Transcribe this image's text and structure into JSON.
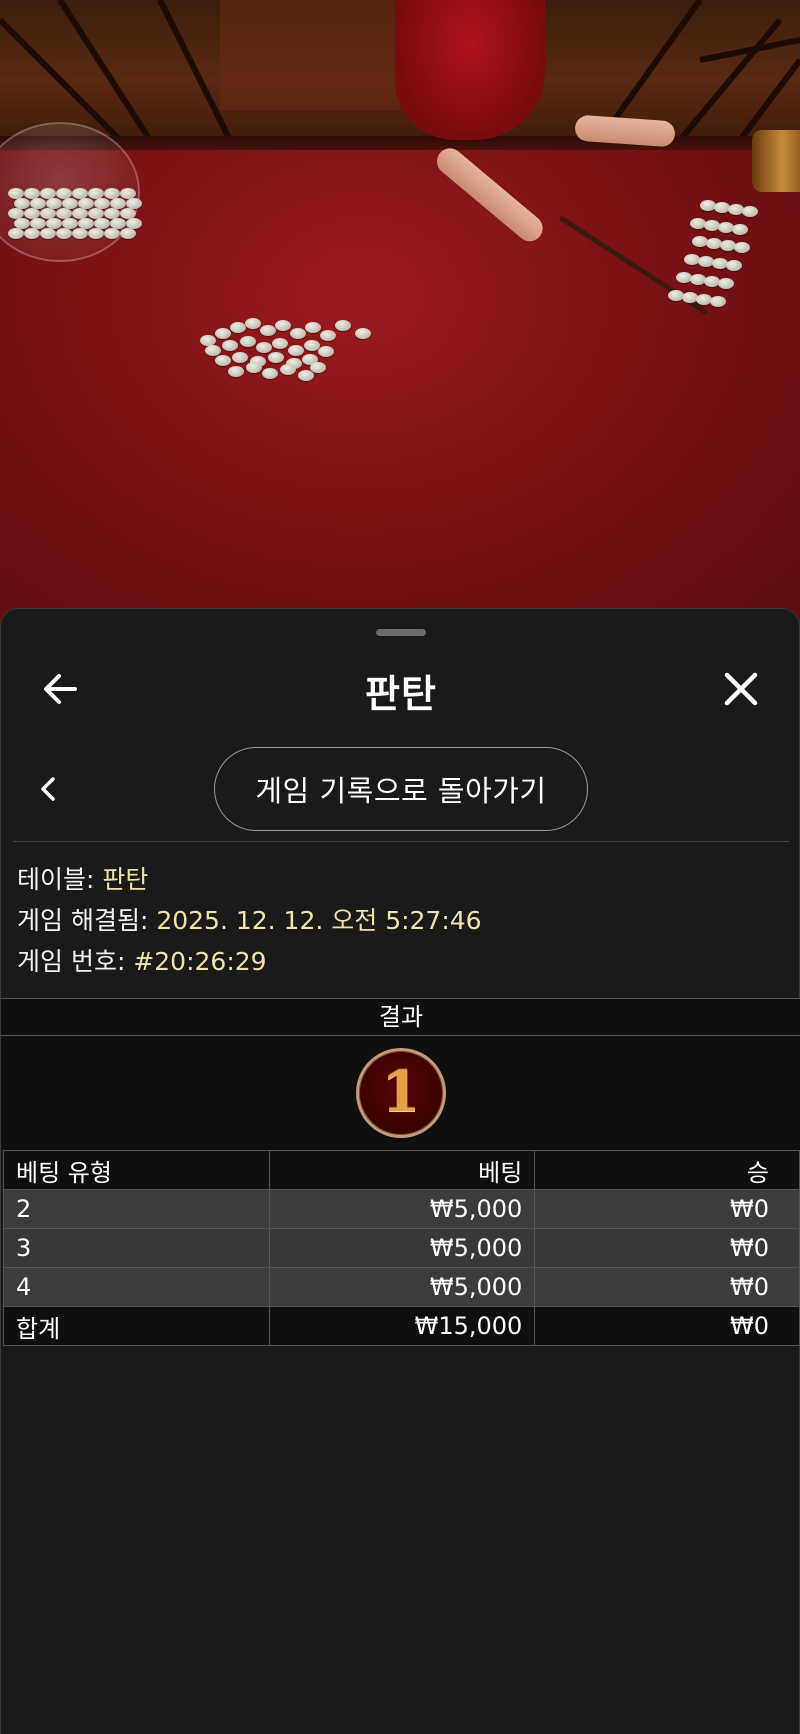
{
  "header": {
    "title": "판탄"
  },
  "nav": {
    "back_to_history_label": "게임 기록으로 돌아가기"
  },
  "info": {
    "table_label": "테이블:",
    "table_value": "판탄",
    "resolved_label": "게임 해결됨:",
    "resolved_value": "2025. 12. 12. 오전 5:27:46",
    "game_no_label": "게임 번호:",
    "game_no_value": "#20:26:29"
  },
  "result": {
    "header": "결과",
    "number": "1"
  },
  "bets": {
    "columns": [
      "베팅 유형",
      "베팅",
      "승"
    ],
    "rows": [
      {
        "type": "2",
        "bet": "₩5,000",
        "win": "₩0"
      },
      {
        "type": "3",
        "bet": "₩5,000",
        "win": "₩0"
      },
      {
        "type": "4",
        "bet": "₩5,000",
        "win": "₩0"
      }
    ],
    "total": {
      "type": "합계",
      "bet": "₩15,000",
      "win": "₩0"
    }
  },
  "icons": {
    "back": "arrow-left-icon",
    "close": "close-icon",
    "prev": "chevron-left-icon"
  },
  "colors": {
    "sheet_bg": "#1a1a1a",
    "value_text": "#f1e3a6",
    "felt": "#7e1317"
  }
}
